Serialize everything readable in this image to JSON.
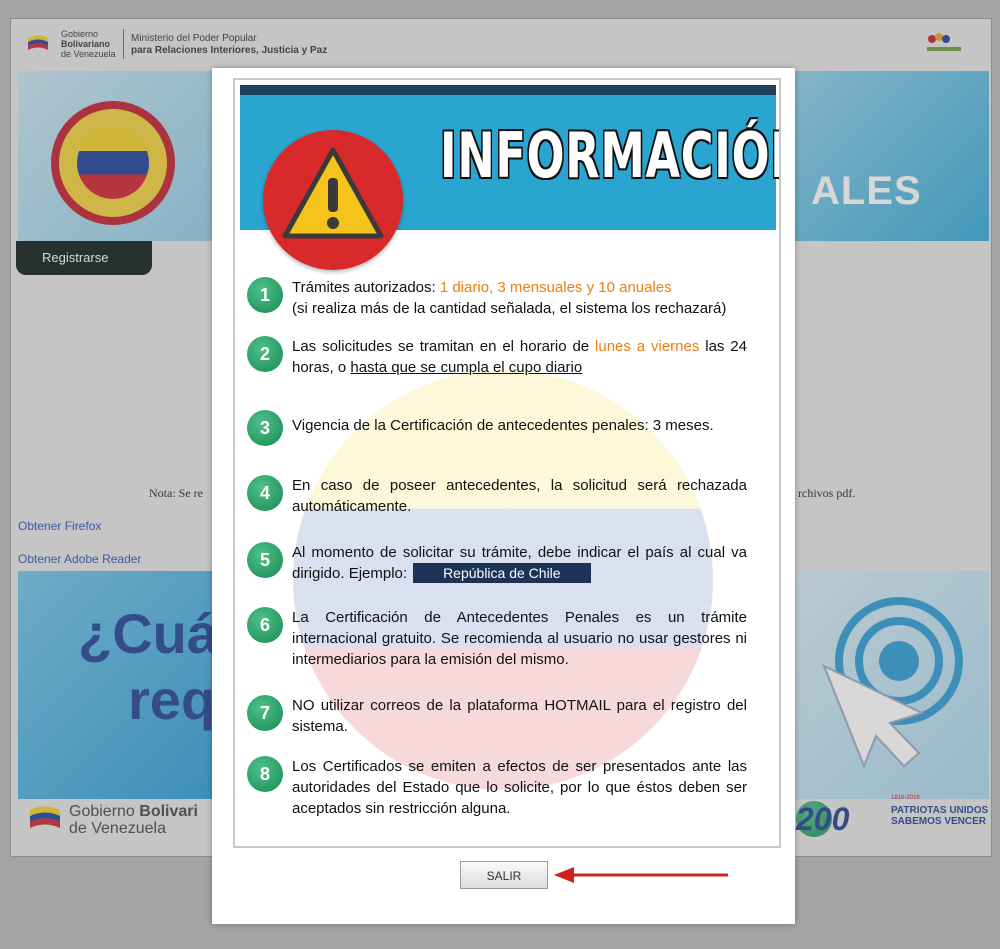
{
  "header": {
    "gov_lines": [
      "Gobierno",
      "Bolivariano",
      "de Venezuela"
    ],
    "ministry_line1": "Ministerio del Poder Popular",
    "ministry_line2": "para Relaciones Interiores, Justicia y Paz"
  },
  "banner": {
    "partial_title": "ALES"
  },
  "register_button": "Registrarse",
  "note": {
    "left": "Nota: Se re",
    "right": "rchivos pdf."
  },
  "links": {
    "firefox": "Obtener Firefox",
    "adobe": "Obtener Adobe Reader"
  },
  "question_banner": {
    "line1": "¿Cuá",
    "line2": "req"
  },
  "footer": {
    "gov_line1_a": "Gobierno ",
    "gov_line1_b": "Bolivari",
    "gov_line2": "de Venezuela",
    "anniv_number": "200",
    "anniv_years": "1816-2016",
    "anniv_line1": "PATRIOTAS UNIDOS",
    "anniv_line2": "SABEMOS VENCER"
  },
  "modal": {
    "title": "INFORMACIÓN",
    "items": [
      {
        "num": "1",
        "a": "Trámites autorizados: ",
        "highlight": "1 diario, 3 mensuales y 10 anuales",
        "b": "(si realiza más de la cantidad señalada, el sistema los rechazará)"
      },
      {
        "num": "2",
        "a": "Las solicitudes se tramitan en el horario de ",
        "highlight": "lunes a viernes",
        "b": " las 24 horas, o ",
        "underline": "hasta que se cumpla el cupo diario"
      },
      {
        "num": "3",
        "text": "Vigencia de la Certificación de antecedentes penales: 3 meses."
      },
      {
        "num": "4",
        "text": "En caso de poseer antecedentes, la solicitud será rechazada automáticamente."
      },
      {
        "num": "5",
        "text": "Al momento de solicitar su trámite, debe indicar el país al cual va dirigido. Ejemplo:",
        "example": "República de Chile"
      },
      {
        "num": "6",
        "text": "La Certificación de Antecedentes Penales es un trámite internacional gratuito. Se recomienda al usuario no usar gestores ni intermediarios para la emisión del mismo."
      },
      {
        "num": "7",
        "text": "NO utilizar correos de la plataforma HOTMAIL para el registro del sistema."
      },
      {
        "num": "8",
        "text": "Los Certificados se emiten a efectos de ser presentados ante las autoridades del Estado que lo solicite, por lo que éstos deben ser aceptados sin restricción alguna."
      }
    ],
    "exit_button": "SALIR"
  },
  "colors": {
    "highlight": "#ef7d10",
    "header_blue": "#2aa5d0",
    "badge_green": "#1c9a5c",
    "arrow_red": "#d0201f"
  }
}
